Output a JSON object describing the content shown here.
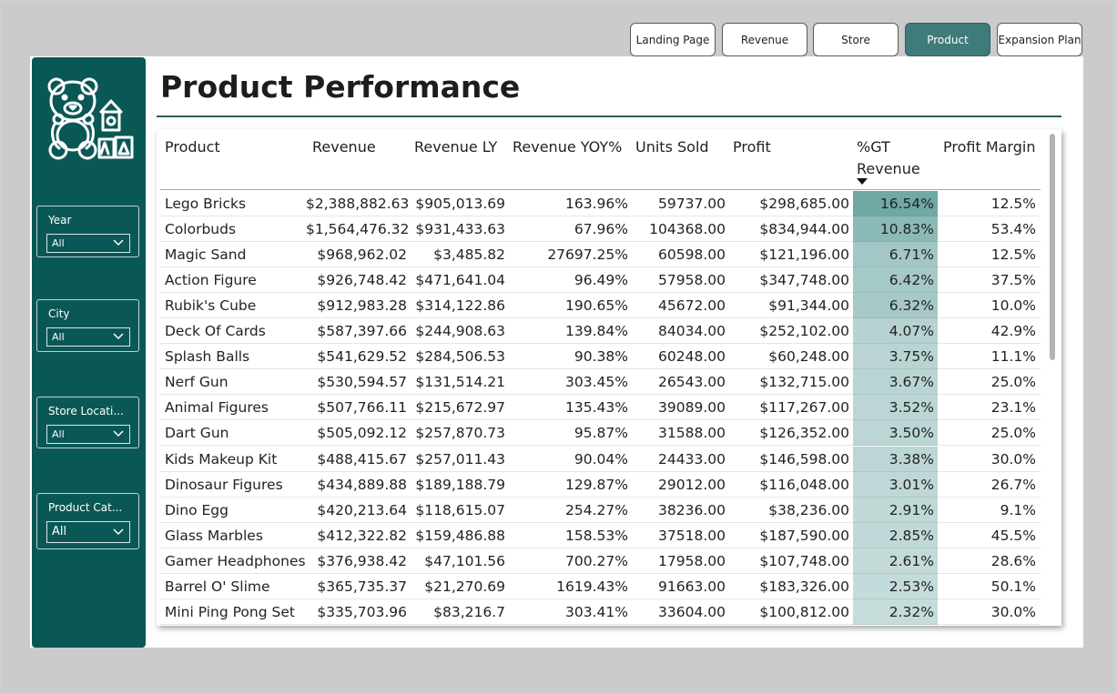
{
  "nav": {
    "buttons": [
      {
        "label": "Landing Page",
        "active": false
      },
      {
        "label": "Revenue",
        "active": false
      },
      {
        "label": "Store",
        "active": false
      },
      {
        "label": "Product",
        "active": true
      },
      {
        "label": "Expansion Plan",
        "active": false
      }
    ]
  },
  "sidebar": {
    "logo_icon": "teddy-bear-blocks-icon",
    "filters": [
      {
        "label": "Year",
        "value": "All"
      },
      {
        "label": "City",
        "value": "All"
      },
      {
        "label": "Store Locati...",
        "value": "All"
      },
      {
        "label": "Product Cat...",
        "value": "All"
      }
    ]
  },
  "page": {
    "title": "Product Performance"
  },
  "table": {
    "columns": [
      "Product",
      "Revenue",
      "Revenue LY",
      "Revenue YOY%",
      "Units Sold",
      "Profit",
      "%GT",
      "Revenue",
      "Profit Margin"
    ],
    "accent_color": "#5f9e9b",
    "rows": [
      {
        "product": "Lego Bricks",
        "revenue": "$2,388,882.63",
        "revenue_ly": "$905,013.69",
        "yoy": "163.96%",
        "units": "59737.00",
        "profit": "$298,685.00",
        "gt": "16.54%",
        "margin": "12.5%"
      },
      {
        "product": "Colorbuds",
        "revenue": "$1,564,476.32",
        "revenue_ly": "$931,433.63",
        "yoy": "67.96%",
        "units": "104368.00",
        "profit": "$834,944.00",
        "gt": "10.83%",
        "margin": "53.4%"
      },
      {
        "product": "Magic Sand",
        "revenue": "$968,962.02",
        "revenue_ly": "$3,485.82",
        "yoy": "27697.25%",
        "units": "60598.00",
        "profit": "$121,196.00",
        "gt": "6.71%",
        "margin": "12.5%"
      },
      {
        "product": "Action Figure",
        "revenue": "$926,748.42",
        "revenue_ly": "$471,641.04",
        "yoy": "96.49%",
        "units": "57958.00",
        "profit": "$347,748.00",
        "gt": "6.42%",
        "margin": "37.5%"
      },
      {
        "product": "Rubik's Cube",
        "revenue": "$912,983.28",
        "revenue_ly": "$314,122.86",
        "yoy": "190.65%",
        "units": "45672.00",
        "profit": "$91,344.00",
        "gt": "6.32%",
        "margin": "10.0%"
      },
      {
        "product": "Deck Of Cards",
        "revenue": "$587,397.66",
        "revenue_ly": "$244,908.63",
        "yoy": "139.84%",
        "units": "84034.00",
        "profit": "$252,102.00",
        "gt": "4.07%",
        "margin": "42.9%"
      },
      {
        "product": "Splash Balls",
        "revenue": "$541,629.52",
        "revenue_ly": "$284,506.53",
        "yoy": "90.38%",
        "units": "60248.00",
        "profit": "$60,248.00",
        "gt": "3.75%",
        "margin": "11.1%"
      },
      {
        "product": "Nerf Gun",
        "revenue": "$530,594.57",
        "revenue_ly": "$131,514.21",
        "yoy": "303.45%",
        "units": "26543.00",
        "profit": "$132,715.00",
        "gt": "3.67%",
        "margin": "25.0%"
      },
      {
        "product": "Animal Figures",
        "revenue": "$507,766.11",
        "revenue_ly": "$215,672.97",
        "yoy": "135.43%",
        "units": "39089.00",
        "profit": "$117,267.00",
        "gt": "3.52%",
        "margin": "23.1%"
      },
      {
        "product": "Dart Gun",
        "revenue": "$505,092.12",
        "revenue_ly": "$257,870.73",
        "yoy": "95.87%",
        "units": "31588.00",
        "profit": "$126,352.00",
        "gt": "3.50%",
        "margin": "25.0%"
      },
      {
        "product": "Kids Makeup Kit",
        "revenue": "$488,415.67",
        "revenue_ly": "$257,011.43",
        "yoy": "90.04%",
        "units": "24433.00",
        "profit": "$146,598.00",
        "gt": "3.38%",
        "margin": "30.0%"
      },
      {
        "product": "Dinosaur Figures",
        "revenue": "$434,889.88",
        "revenue_ly": "$189,188.79",
        "yoy": "129.87%",
        "units": "29012.00",
        "profit": "$116,048.00",
        "gt": "3.01%",
        "margin": "26.7%"
      },
      {
        "product": "Dino Egg",
        "revenue": "$420,213.64",
        "revenue_ly": "$118,615.07",
        "yoy": "254.27%",
        "units": "38236.00",
        "profit": "$38,236.00",
        "gt": "2.91%",
        "margin": "9.1%"
      },
      {
        "product": "Glass Marbles",
        "revenue": "$412,322.82",
        "revenue_ly": "$159,486.88",
        "yoy": "158.53%",
        "units": "37518.00",
        "profit": "$187,590.00",
        "gt": "2.85%",
        "margin": "45.5%"
      },
      {
        "product": "Gamer Headphones",
        "revenue": "$376,938.42",
        "revenue_ly": "$47,101.56",
        "yoy": "700.27%",
        "units": "17958.00",
        "profit": "$107,748.00",
        "gt": "2.61%",
        "margin": "28.6%"
      },
      {
        "product": "Barrel O' Slime",
        "revenue": "$365,735.37",
        "revenue_ly": "$21,270.69",
        "yoy": "1619.43%",
        "units": "91663.00",
        "profit": "$183,326.00",
        "gt": "2.53%",
        "margin": "50.1%"
      },
      {
        "product": "Mini Ping Pong Set",
        "revenue": "$335,703.96",
        "revenue_ly": "$83,216.7",
        "yoy": "303.41%",
        "units": "33604.00",
        "profit": "$100,812.00",
        "gt": "2.32%",
        "margin": "30.0%"
      }
    ]
  }
}
